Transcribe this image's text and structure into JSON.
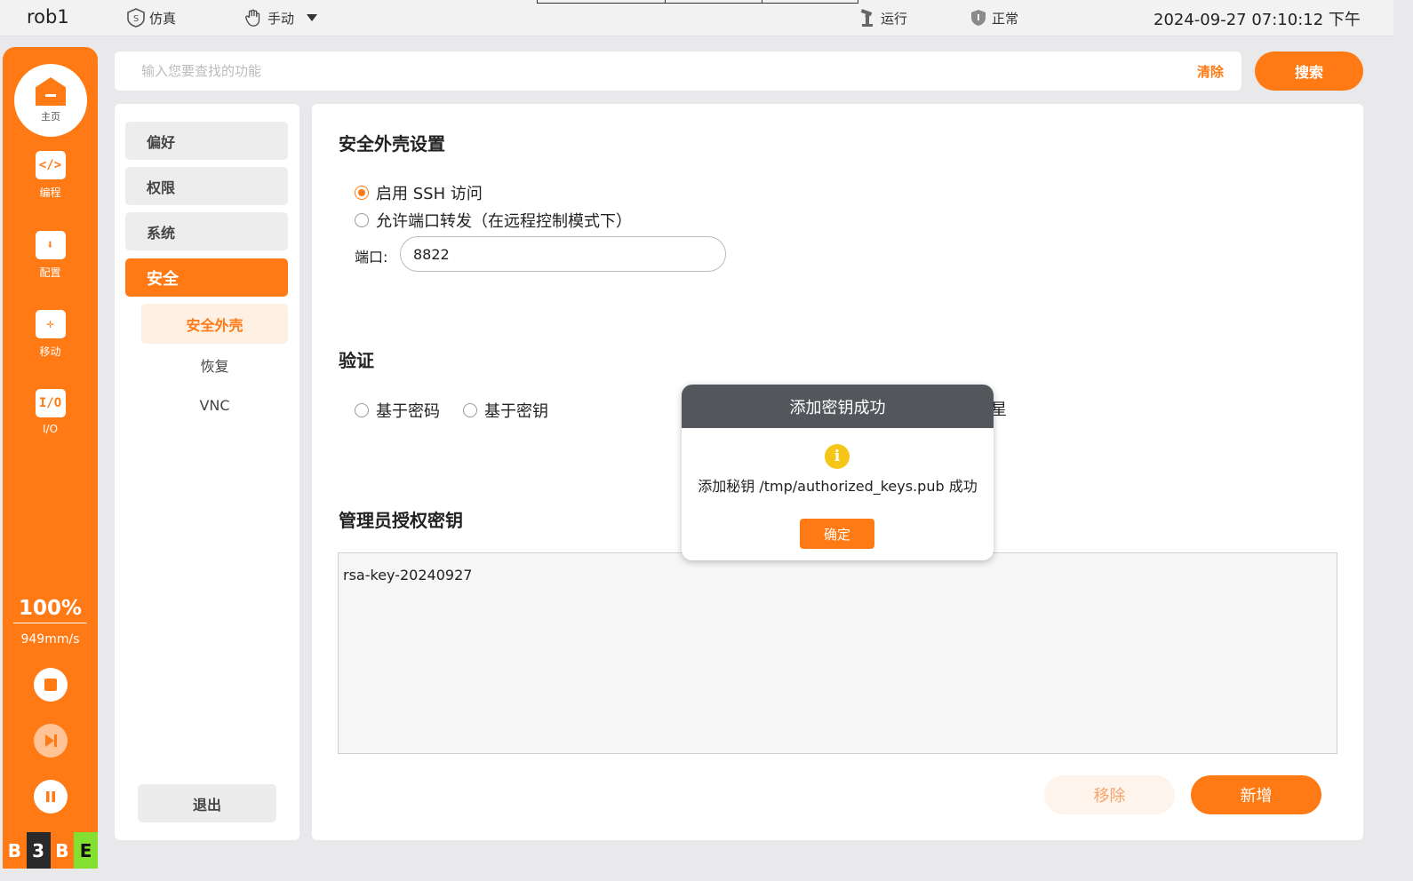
{
  "topbar": {
    "robot_name": "rob1",
    "mode": "仿真",
    "operation": "手动",
    "run_state": "运行",
    "health": "正常",
    "datetime": "2024-09-27 07:10:12 下午"
  },
  "sidebar": {
    "home": "主页",
    "items": [
      {
        "label": "编程",
        "icon": "code-icon",
        "glyph": "</>"
      },
      {
        "label": "配置",
        "icon": "download-book-icon",
        "glyph": "⬇"
      },
      {
        "label": "移动",
        "icon": "move-arrows-icon",
        "glyph": "✛"
      },
      {
        "label": "I/O",
        "icon": "io-icon",
        "glyph": "I/O"
      }
    ],
    "speed_percent": "100%",
    "speed_value": "949mm/s",
    "status_letters": [
      "B",
      "3",
      "B",
      "E"
    ],
    "status_colors": [
      "#ff7a14",
      "#2a2a2a",
      "#ff7a14",
      "#84e030"
    ]
  },
  "search": {
    "placeholder": "输入您要查找的功能",
    "value": "",
    "clear_label": "清除",
    "button_label": "搜索"
  },
  "menu": {
    "items": [
      "偏好",
      "权限",
      "系统",
      "安全"
    ],
    "active": "安全",
    "sub_items": [
      "安全外壳",
      "恢复",
      "VNC"
    ],
    "active_sub": "安全外壳",
    "logout": "退出"
  },
  "content": {
    "ssh_title": "安全外壳设置",
    "enable_ssh": "启用 SSH 访问",
    "enable_ssh_checked": true,
    "port_forward": "允许端口转发（在远程控制模式下）",
    "port_forward_checked": false,
    "port_label": "端口:",
    "port_value": "8822",
    "auth_title": "验证",
    "auth_password": "基于密码",
    "auth_key": "基于密钥",
    "auth_trailing_fragment": "星",
    "keys_title": "管理员授权密钥",
    "keys": [
      "rsa-key-20240927"
    ],
    "remove_label": "移除",
    "add_label": "新增"
  },
  "dialog": {
    "title": "添加密钥成功",
    "message": "添加秘钥 /tmp/authorized_keys.pub 成功",
    "ok_label": "确定",
    "icon": "info-icon"
  },
  "colors": {
    "accent": "#ff7a14",
    "dialog_header": "#53575b"
  }
}
